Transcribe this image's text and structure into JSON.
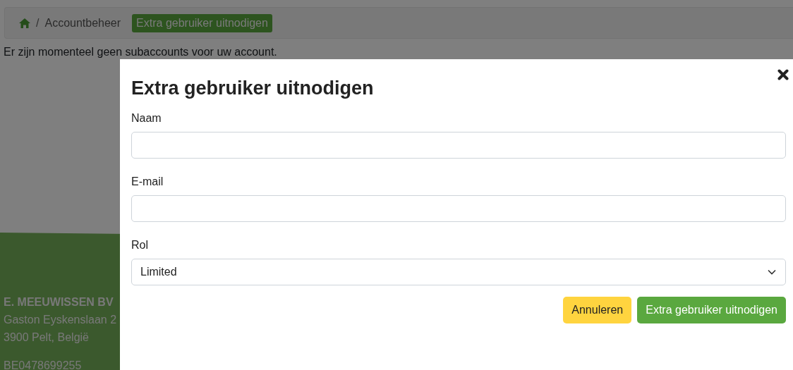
{
  "breadcrumb": {
    "separator": "/",
    "items": [
      "Accountbeheer"
    ],
    "current": "Extra gebruiker uitnodigen"
  },
  "message": "Er zijn momenteel geen subaccounts voor uw account.",
  "footer": {
    "company": "E. MEEUWISSEN BV",
    "lines": [
      "Gaston Eyskenslaan 2",
      "3900 Pelt, België"
    ],
    "vat": "BE0478699255"
  },
  "modal": {
    "title": "Extra gebruiker uitnodigen",
    "fields": [
      {
        "kind": "text",
        "label": "Naam"
      },
      {
        "kind": "text",
        "label": "E-mail"
      },
      {
        "kind": "select",
        "label": "Rol",
        "value": "Limited"
      }
    ],
    "buttons": [
      {
        "kind": "cancel",
        "label": "Annuleren"
      },
      {
        "kind": "primary",
        "label": "Extra gebruiker uitnodigen"
      }
    ]
  }
}
